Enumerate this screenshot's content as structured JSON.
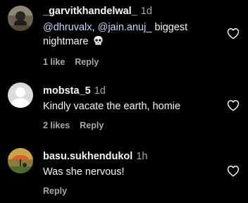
{
  "comments": [
    {
      "username": "_garvitkhandelwal_",
      "time": "1d",
      "mention1": "@dhruvalx",
      "separator": ",",
      "mention2": "@jain.anuj_",
      "text_after": "biggest",
      "text_line2": "nightmare",
      "emoji": "skull",
      "likes": "1 like",
      "reply": "Reply"
    },
    {
      "username": "mobsta_5",
      "time": "1d",
      "text": "Kindly vacate the earth, homie",
      "likes": "2 likes",
      "reply": "Reply"
    },
    {
      "username": "basu.sukhendukol",
      "time": "1h",
      "text": "Was she nervous!",
      "reply": "Reply"
    }
  ],
  "colors": {
    "background": "#000000",
    "text": "#f5f5f5",
    "secondary": "#a8a8a8",
    "mention": "#c7d7ff"
  }
}
